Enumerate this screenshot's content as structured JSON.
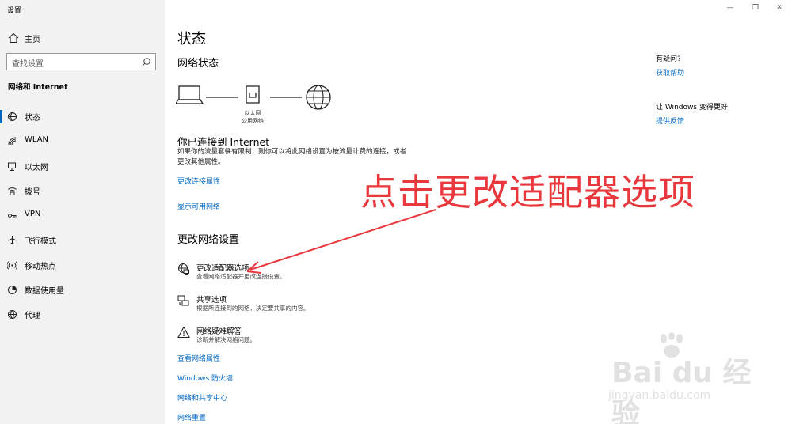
{
  "window": {
    "title": "设置",
    "controls": {
      "minimize": "—",
      "restore": "❐",
      "close": "✕"
    }
  },
  "sidebar": {
    "home_label": "主页",
    "search_placeholder": "查找设置",
    "section": "网络和 Internet",
    "items": [
      {
        "label": "状态",
        "icon": "status-icon",
        "active": true
      },
      {
        "label": "WLAN",
        "icon": "wlan-icon"
      },
      {
        "label": "以太网",
        "icon": "ethernet-icon"
      },
      {
        "label": "拨号",
        "icon": "dialup-icon"
      },
      {
        "label": "VPN",
        "icon": "vpn-icon"
      },
      {
        "label": "飞行模式",
        "icon": "airplane-icon"
      },
      {
        "label": "移动热点",
        "icon": "hotspot-icon"
      },
      {
        "label": "数据使用量",
        "icon": "data-usage-icon"
      },
      {
        "label": "代理",
        "icon": "proxy-icon"
      }
    ]
  },
  "main": {
    "title": "状态",
    "network_status_title": "网络状态",
    "diagram": {
      "adapter_name": "以太网",
      "network_type": "公用网络"
    },
    "connected_title": "你已连接到 Internet",
    "connected_desc": "如果你的流量套餐有限制，则你可以将此网络设置为按流量计费的连接，或者更改其他属性。",
    "link_change_props": "更改连接属性",
    "link_show_networks": "显示可用网络",
    "change_settings_title": "更改网络设置",
    "options": [
      {
        "title": "更改适配器选项",
        "desc": "查看网络适配器并更改连接设置。",
        "icon": "adapter-icon"
      },
      {
        "title": "共享选项",
        "desc": "根据所连接到的网络，决定要共享的内容。",
        "icon": "sharing-icon"
      },
      {
        "title": "网络疑难解答",
        "desc": "诊断并解决网络问题。",
        "icon": "troubleshoot-icon"
      }
    ],
    "links_bottom": [
      "查看网络属性",
      "Windows 防火墙",
      "网络和共享中心",
      "网络重置"
    ]
  },
  "right": {
    "question": "有疑问?",
    "get_help": "获取帮助",
    "improve": "让 Windows 变得更好",
    "feedback": "提供反馈"
  },
  "overlay": {
    "annotation": "点击更改适配器选项",
    "watermark_main": "Bai du 经验",
    "watermark_sub": "jingyan.baidu.com"
  },
  "colors": {
    "accent": "#0067c0",
    "annotation": "#e8383d",
    "sidebar_bg": "#f2f2f2"
  }
}
